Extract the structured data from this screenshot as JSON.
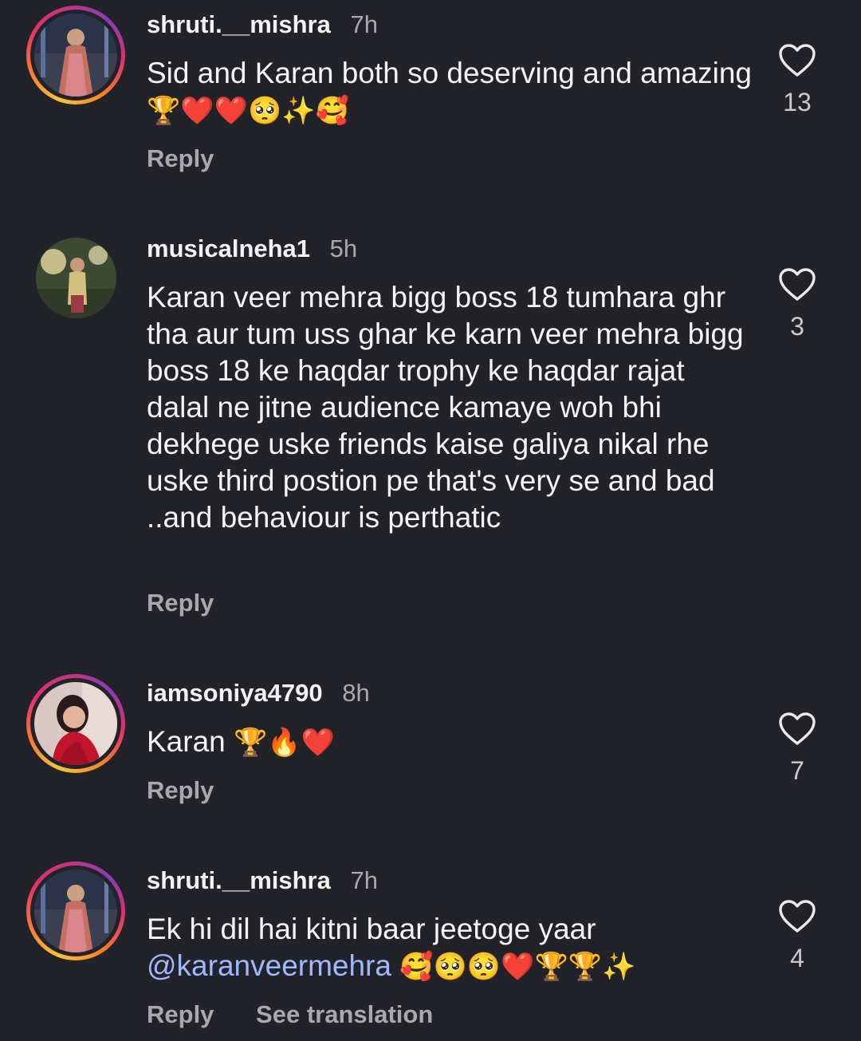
{
  "comments": [
    {
      "username": "shruti.__mishra",
      "time": "7h",
      "text": "Sid and Karan both so deserving and amazing",
      "emojis": "🏆❤️❤️🥺✨🥰",
      "reply_label": "Reply",
      "likes": "13",
      "has_story_ring": true
    },
    {
      "username": "musicalneha1",
      "time": "5h",
      "text": "Karan veer mehra bigg boss 18 tumhara ghr tha aur tum uss ghar ke karn veer mehra bigg boss 18 ke haqdar trophy ke haqdar rajat dalal ne jitne audience kamaye woh bhi dekhege uske friends kaise galiya nikal rhe uske third postion pe that's very se and bad ..and behaviour is perthatic",
      "reply_label": "Reply",
      "likes": "3",
      "has_story_ring": false
    },
    {
      "username": "iamsoniya4790",
      "time": "8h",
      "text": "Karan",
      "emojis": "🏆🔥❤️",
      "reply_label": "Reply",
      "likes": "7",
      "has_story_ring": true
    },
    {
      "username": "shruti.__mishra",
      "time": "7h",
      "text": "Ek hi dil hai kitni baar jeetoge yaar",
      "mention": "@karanveermehra",
      "emojis": "🥰🥺🥺❤️🏆🏆✨",
      "reply_label": "Reply",
      "see_translation_label": "See translation",
      "likes": "4",
      "has_story_ring": true
    }
  ]
}
